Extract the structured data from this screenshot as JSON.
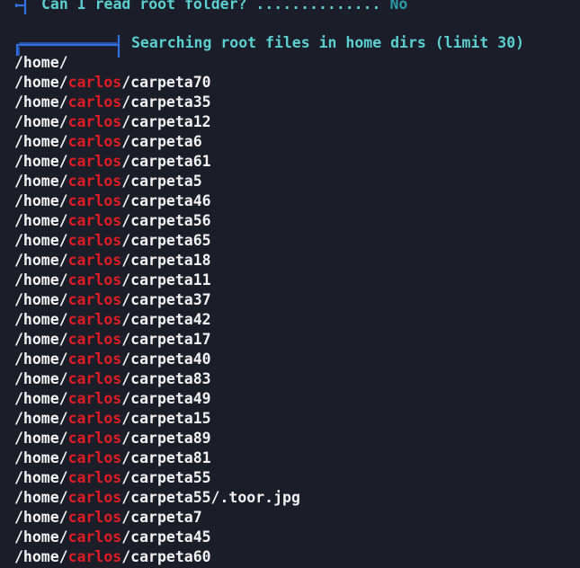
{
  "previous_check": {
    "label": "Can I read root folder? ..............",
    "answer": "No"
  },
  "section": {
    "title": "Searching root files in home dirs (limit 30)"
  },
  "colors": {
    "background": "#1b1d28",
    "heading": "#5bcfcf",
    "answer": "#2a9aa8",
    "highlight_user": "#e01b24",
    "text": "#f2f2f2"
  },
  "home_root": "/home/",
  "paths": [
    {
      "prefix": "/home/",
      "user": "carlos",
      "rest": "/carpeta70"
    },
    {
      "prefix": "/home/",
      "user": "carlos",
      "rest": "/carpeta35"
    },
    {
      "prefix": "/home/",
      "user": "carlos",
      "rest": "/carpeta12"
    },
    {
      "prefix": "/home/",
      "user": "carlos",
      "rest": "/carpeta6"
    },
    {
      "prefix": "/home/",
      "user": "carlos",
      "rest": "/carpeta61"
    },
    {
      "prefix": "/home/",
      "user": "carlos",
      "rest": "/carpeta5"
    },
    {
      "prefix": "/home/",
      "user": "carlos",
      "rest": "/carpeta46"
    },
    {
      "prefix": "/home/",
      "user": "carlos",
      "rest": "/carpeta56"
    },
    {
      "prefix": "/home/",
      "user": "carlos",
      "rest": "/carpeta65"
    },
    {
      "prefix": "/home/",
      "user": "carlos",
      "rest": "/carpeta18"
    },
    {
      "prefix": "/home/",
      "user": "carlos",
      "rest": "/carpeta11"
    },
    {
      "prefix": "/home/",
      "user": "carlos",
      "rest": "/carpeta37"
    },
    {
      "prefix": "/home/",
      "user": "carlos",
      "rest": "/carpeta42"
    },
    {
      "prefix": "/home/",
      "user": "carlos",
      "rest": "/carpeta17"
    },
    {
      "prefix": "/home/",
      "user": "carlos",
      "rest": "/carpeta40"
    },
    {
      "prefix": "/home/",
      "user": "carlos",
      "rest": "/carpeta83"
    },
    {
      "prefix": "/home/",
      "user": "carlos",
      "rest": "/carpeta49"
    },
    {
      "prefix": "/home/",
      "user": "carlos",
      "rest": "/carpeta15"
    },
    {
      "prefix": "/home/",
      "user": "carlos",
      "rest": "/carpeta89"
    },
    {
      "prefix": "/home/",
      "user": "carlos",
      "rest": "/carpeta81"
    },
    {
      "prefix": "/home/",
      "user": "carlos",
      "rest": "/carpeta55"
    },
    {
      "prefix": "/home/",
      "user": "carlos",
      "rest": "/carpeta55/.toor.jpg"
    },
    {
      "prefix": "/home/",
      "user": "carlos",
      "rest": "/carpeta7"
    },
    {
      "prefix": "/home/",
      "user": "carlos",
      "rest": "/carpeta45"
    },
    {
      "prefix": "/home/",
      "user": "carlos",
      "rest": "/carpeta60"
    }
  ]
}
